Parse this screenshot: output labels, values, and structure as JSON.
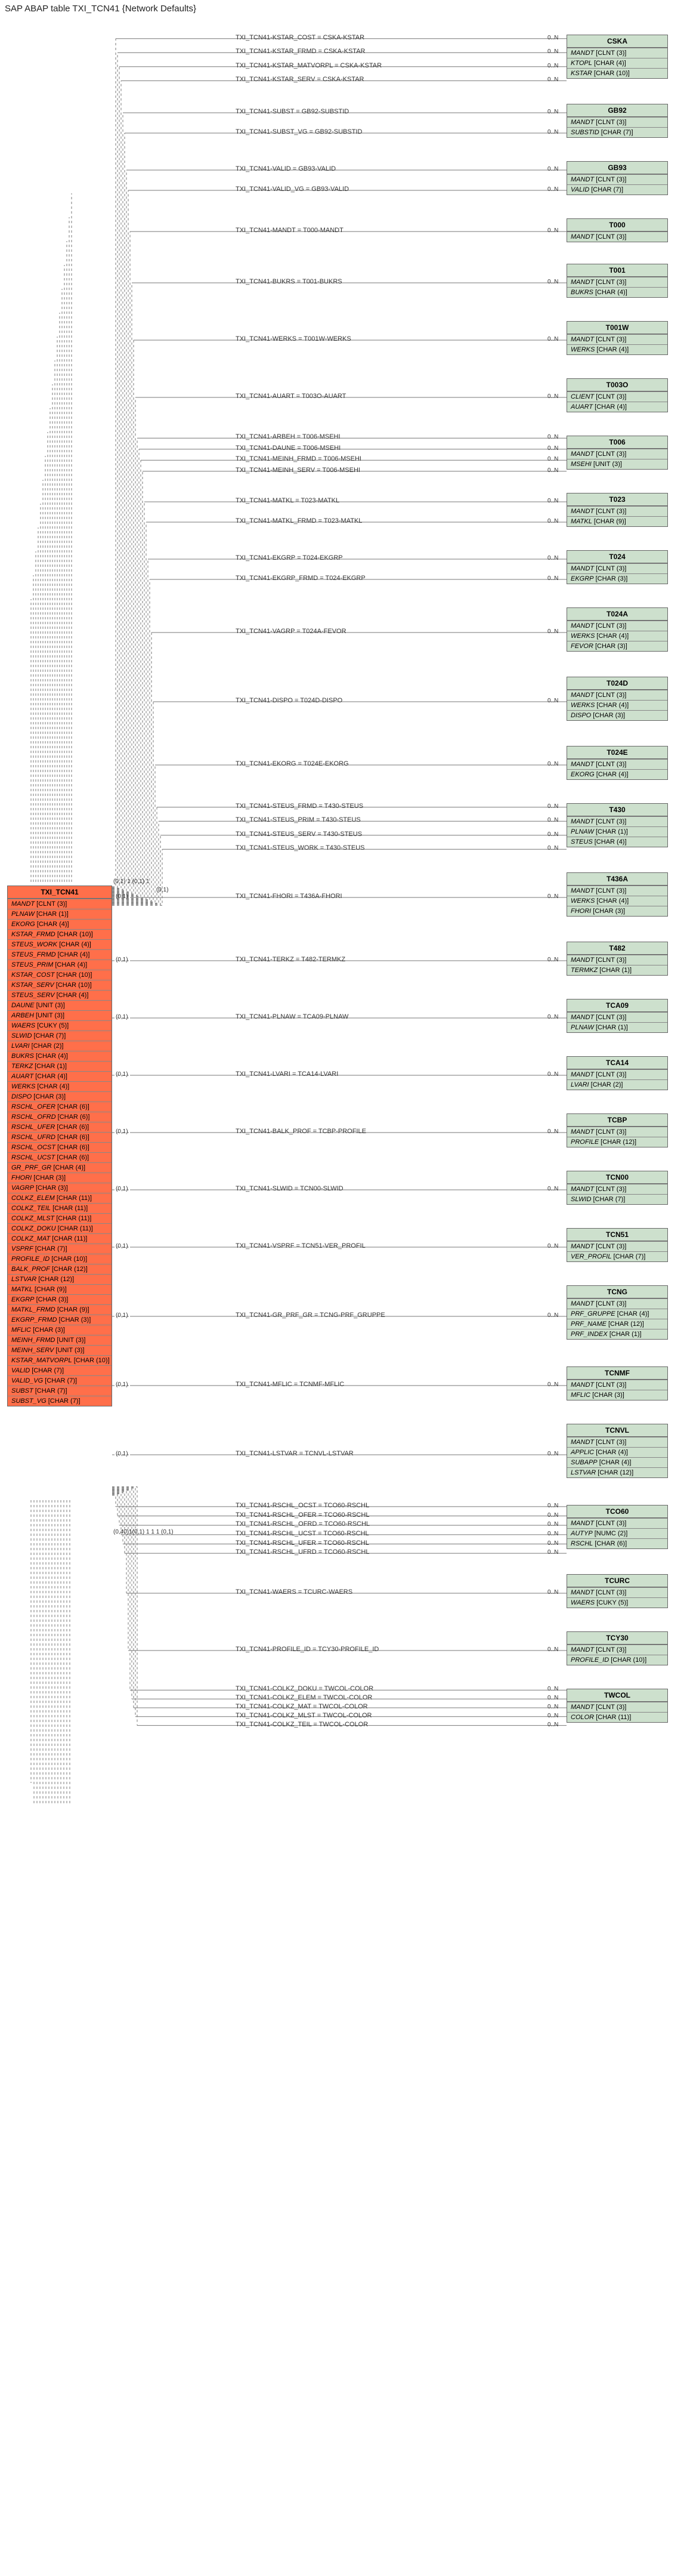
{
  "title": "SAP ABAP table TXI_TCN41 {Network Defaults}",
  "main_table": {
    "name": "TXI_TCN41",
    "fields": [
      {
        "name": "MANDT",
        "type": "[CLNT (3)]"
      },
      {
        "name": "PLNAW",
        "type": "[CHAR (1)]"
      },
      {
        "name": "EKORG",
        "type": "[CHAR (4)]"
      },
      {
        "name": "KSTAR_FRMD",
        "type": "[CHAR (10)]"
      },
      {
        "name": "STEUS_WORK",
        "type": "[CHAR (4)]"
      },
      {
        "name": "STEUS_FRMD",
        "type": "[CHAR (4)]"
      },
      {
        "name": "STEUS_PRIM",
        "type": "[CHAR (4)]"
      },
      {
        "name": "KSTAR_COST",
        "type": "[CHAR (10)]"
      },
      {
        "name": "KSTAR_SERV",
        "type": "[CHAR (10)]"
      },
      {
        "name": "STEUS_SERV",
        "type": "[CHAR (4)]"
      },
      {
        "name": "DAUNE",
        "type": "[UNIT (3)]"
      },
      {
        "name": "ARBEH",
        "type": "[UNIT (3)]"
      },
      {
        "name": "WAERS",
        "type": "[CUKY (5)]"
      },
      {
        "name": "SLWID",
        "type": "[CHAR (7)]"
      },
      {
        "name": "LVARI",
        "type": "[CHAR (2)]"
      },
      {
        "name": "BUKRS",
        "type": "[CHAR (4)]"
      },
      {
        "name": "TERKZ",
        "type": "[CHAR (1)]"
      },
      {
        "name": "AUART",
        "type": "[CHAR (4)]"
      },
      {
        "name": "WERKS",
        "type": "[CHAR (4)]"
      },
      {
        "name": "DISPO",
        "type": "[CHAR (3)]"
      },
      {
        "name": "RSCHL_OFER",
        "type": "[CHAR (6)]"
      },
      {
        "name": "RSCHL_OFRD",
        "type": "[CHAR (6)]"
      },
      {
        "name": "RSCHL_UFER",
        "type": "[CHAR (6)]"
      },
      {
        "name": "RSCHL_UFRD",
        "type": "[CHAR (6)]"
      },
      {
        "name": "RSCHL_OCST",
        "type": "[CHAR (6)]"
      },
      {
        "name": "RSCHL_UCST",
        "type": "[CHAR (6)]"
      },
      {
        "name": "GR_PRF_GR",
        "type": "[CHAR (4)]"
      },
      {
        "name": "FHORI",
        "type": "[CHAR (3)]"
      },
      {
        "name": "VAGRP",
        "type": "[CHAR (3)]"
      },
      {
        "name": "COLKZ_ELEM",
        "type": "[CHAR (11)]"
      },
      {
        "name": "COLKZ_TEIL",
        "type": "[CHAR (11)]"
      },
      {
        "name": "COLKZ_MLST",
        "type": "[CHAR (11)]"
      },
      {
        "name": "COLKZ_DOKU",
        "type": "[CHAR (11)]"
      },
      {
        "name": "COLKZ_MAT",
        "type": "[CHAR (11)]"
      },
      {
        "name": "VSPRF",
        "type": "[CHAR (7)]"
      },
      {
        "name": "PROFILE_ID",
        "type": "[CHAR (10)]"
      },
      {
        "name": "BALK_PROF",
        "type": "[CHAR (12)]"
      },
      {
        "name": "LSTVAR",
        "type": "[CHAR (12)]"
      },
      {
        "name": "MATKL",
        "type": "[CHAR (9)]"
      },
      {
        "name": "EKGRP",
        "type": "[CHAR (3)]"
      },
      {
        "name": "MATKL_FRMD",
        "type": "[CHAR (9)]"
      },
      {
        "name": "EKGRP_FRMD",
        "type": "[CHAR (3)]"
      },
      {
        "name": "MFLIC",
        "type": "[CHAR (3)]"
      },
      {
        "name": "MEINH_FRMD",
        "type": "[UNIT (3)]"
      },
      {
        "name": "MEINH_SERV",
        "type": "[UNIT (3)]"
      },
      {
        "name": "KSTAR_MATVORPL",
        "type": "[CHAR (10)]"
      },
      {
        "name": "VALID",
        "type": "[CHAR (7)]"
      },
      {
        "name": "VALID_VG",
        "type": "[CHAR (7)]"
      },
      {
        "name": "SUBST",
        "type": "[CHAR (7)]"
      },
      {
        "name": "SUBST_VG",
        "type": "[CHAR (7)]"
      }
    ]
  },
  "right_tables": [
    {
      "key": "CSKA",
      "name": "CSKA",
      "fields": [
        {
          "name": "MANDT",
          "type": "[CLNT (3)]"
        },
        {
          "name": "KTOPL",
          "type": "[CHAR (4)]"
        },
        {
          "name": "KSTAR",
          "type": "[CHAR (10)]"
        }
      ]
    },
    {
      "key": "GB92",
      "name": "GB92",
      "fields": [
        {
          "name": "MANDT",
          "type": "[CLNT (3)]"
        },
        {
          "name": "SUBSTID",
          "type": "[CHAR (7)]"
        }
      ]
    },
    {
      "key": "GB93",
      "name": "GB93",
      "fields": [
        {
          "name": "MANDT",
          "type": "[CLNT (3)]"
        },
        {
          "name": "VALID",
          "type": "[CHAR (7)]"
        }
      ]
    },
    {
      "key": "T000",
      "name": "T000",
      "fields": [
        {
          "name": "MANDT",
          "type": "[CLNT (3)]"
        }
      ]
    },
    {
      "key": "T001",
      "name": "T001",
      "fields": [
        {
          "name": "MANDT",
          "type": "[CLNT (3)]"
        },
        {
          "name": "BUKRS",
          "type": "[CHAR (4)]"
        }
      ]
    },
    {
      "key": "T001W",
      "name": "T001W",
      "fields": [
        {
          "name": "MANDT",
          "type": "[CLNT (3)]"
        },
        {
          "name": "WERKS",
          "type": "[CHAR (4)]"
        }
      ]
    },
    {
      "key": "T003O",
      "name": "T003O",
      "fields": [
        {
          "name": "CLIENT",
          "type": "[CLNT (3)]"
        },
        {
          "name": "AUART",
          "type": "[CHAR (4)]"
        }
      ]
    },
    {
      "key": "T006",
      "name": "T006",
      "fields": [
        {
          "name": "MANDT",
          "type": "[CLNT (3)]"
        },
        {
          "name": "MSEHI",
          "type": "[UNIT (3)]"
        }
      ]
    },
    {
      "key": "T023",
      "name": "T023",
      "fields": [
        {
          "name": "MANDT",
          "type": "[CLNT (3)]"
        },
        {
          "name": "MATKL",
          "type": "[CHAR (9)]"
        }
      ]
    },
    {
      "key": "T024",
      "name": "T024",
      "fields": [
        {
          "name": "MANDT",
          "type": "[CLNT (3)]"
        },
        {
          "name": "EKGRP",
          "type": "[CHAR (3)]"
        }
      ]
    },
    {
      "key": "T024A",
      "name": "T024A",
      "fields": [
        {
          "name": "MANDT",
          "type": "[CLNT (3)]"
        },
        {
          "name": "WERKS",
          "type": "[CHAR (4)]"
        },
        {
          "name": "FEVOR",
          "type": "[CHAR (3)]"
        }
      ]
    },
    {
      "key": "T024D",
      "name": "T024D",
      "fields": [
        {
          "name": "MANDT",
          "type": "[CLNT (3)]"
        },
        {
          "name": "WERKS",
          "type": "[CHAR (4)]"
        },
        {
          "name": "DISPO",
          "type": "[CHAR (3)]"
        }
      ]
    },
    {
      "key": "T024E",
      "name": "T024E",
      "fields": [
        {
          "name": "MANDT",
          "type": "[CLNT (3)]"
        },
        {
          "name": "EKORG",
          "type": "[CHAR (4)]"
        }
      ]
    },
    {
      "key": "T430",
      "name": "T430",
      "fields": [
        {
          "name": "MANDT",
          "type": "[CLNT (3)]"
        },
        {
          "name": "PLNAW",
          "type": "[CHAR (1)]"
        },
        {
          "name": "STEUS",
          "type": "[CHAR (4)]"
        }
      ]
    },
    {
      "key": "T436A",
      "name": "T436A",
      "fields": [
        {
          "name": "MANDT",
          "type": "[CLNT (3)]"
        },
        {
          "name": "WERKS",
          "type": "[CHAR (4)]"
        },
        {
          "name": "FHORI",
          "type": "[CHAR (3)]"
        }
      ]
    },
    {
      "key": "T482",
      "name": "T482",
      "fields": [
        {
          "name": "MANDT",
          "type": "[CLNT (3)]"
        },
        {
          "name": "TERMKZ",
          "type": "[CHAR (1)]"
        }
      ]
    },
    {
      "key": "TCA09",
      "name": "TCA09",
      "fields": [
        {
          "name": "MANDT",
          "type": "[CLNT (3)]"
        },
        {
          "name": "PLNAW",
          "type": "[CHAR (1)]"
        }
      ]
    },
    {
      "key": "TCA14",
      "name": "TCA14",
      "fields": [
        {
          "name": "MANDT",
          "type": "[CLNT (3)]"
        },
        {
          "name": "LVARI",
          "type": "[CHAR (2)]"
        }
      ]
    },
    {
      "key": "TCBP",
      "name": "TCBP",
      "fields": [
        {
          "name": "MANDT",
          "type": "[CLNT (3)]"
        },
        {
          "name": "PROFILE",
          "type": "[CHAR (12)]"
        }
      ]
    },
    {
      "key": "TCN00",
      "name": "TCN00",
      "fields": [
        {
          "name": "MANDT",
          "type": "[CLNT (3)]"
        },
        {
          "name": "SLWID",
          "type": "[CHAR (7)]"
        }
      ]
    },
    {
      "key": "TCN51",
      "name": "TCN51",
      "fields": [
        {
          "name": "MANDT",
          "type": "[CLNT (3)]"
        },
        {
          "name": "VER_PROFIL",
          "type": "[CHAR (7)]"
        }
      ]
    },
    {
      "key": "TCNG",
      "name": "TCNG",
      "fields": [
        {
          "name": "MANDT",
          "type": "[CLNT (3)]"
        },
        {
          "name": "PRF_GRUPPE",
          "type": "[CHAR (4)]"
        },
        {
          "name": "PRF_NAME",
          "type": "[CHAR (12)]"
        },
        {
          "name": "PRF_INDEX",
          "type": "[CHAR (1)]"
        }
      ]
    },
    {
      "key": "TCNMF",
      "name": "TCNMF",
      "fields": [
        {
          "name": "MANDT",
          "type": "[CLNT (3)]"
        },
        {
          "name": "MFLIC",
          "type": "[CHAR (3)]"
        }
      ]
    },
    {
      "key": "TCNVL",
      "name": "TCNVL",
      "fields": [
        {
          "name": "MANDT",
          "type": "[CLNT (3)]"
        },
        {
          "name": "APPLIC",
          "type": "[CHAR (4)]"
        },
        {
          "name": "SUBAPP",
          "type": "[CHAR (4)]"
        },
        {
          "name": "LSTVAR",
          "type": "[CHAR (12)]"
        }
      ]
    },
    {
      "key": "TCO60",
      "name": "TCO60",
      "fields": [
        {
          "name": "MANDT",
          "type": "[CLNT (3)]"
        },
        {
          "name": "AUTYP",
          "type": "[NUMC (2)]"
        },
        {
          "name": "RSCHL",
          "type": "[CHAR (6)]"
        }
      ]
    },
    {
      "key": "TCURC",
      "name": "TCURC",
      "fields": [
        {
          "name": "MANDT",
          "type": "[CLNT (3)]"
        },
        {
          "name": "WAERS",
          "type": "[CUKY (5)]"
        }
      ]
    },
    {
      "key": "TCY30",
      "name": "TCY30",
      "fields": [
        {
          "name": "MANDT",
          "type": "[CLNT (3)]"
        },
        {
          "name": "PROFILE_ID",
          "type": "[CHAR (10)]"
        }
      ]
    },
    {
      "key": "TWCOL",
      "name": "TWCOL",
      "fields": [
        {
          "name": "MANDT",
          "type": "[CLNT (3)]"
        },
        {
          "name": "COLOR",
          "type": "[CHAR (11)]"
        }
      ]
    }
  ],
  "edges": [
    {
      "label": "TXI_TCN41-KSTAR_COST = CSKA-KSTAR",
      "target": "CSKA",
      "rc": "0..N"
    },
    {
      "label": "TXI_TCN41-KSTAR_FRMD = CSKA-KSTAR",
      "target": "CSKA",
      "rc": "0..N"
    },
    {
      "label": "TXI_TCN41-KSTAR_MATVORPL = CSKA-KSTAR",
      "target": "CSKA",
      "rc": "0..N"
    },
    {
      "label": "TXI_TCN41-KSTAR_SERV = CSKA-KSTAR",
      "target": "CSKA",
      "rc": "0..N"
    },
    {
      "label": "TXI_TCN41-SUBST = GB92-SUBSTID",
      "target": "GB92",
      "rc": "0..N"
    },
    {
      "label": "TXI_TCN41-SUBST_VG = GB92-SUBSTID",
      "target": "GB92",
      "rc": "0..N"
    },
    {
      "label": "TXI_TCN41-VALID = GB93-VALID",
      "target": "GB93",
      "rc": "0..N"
    },
    {
      "label": "TXI_TCN41-VALID_VG = GB93-VALID",
      "target": "GB93",
      "rc": "0..N"
    },
    {
      "label": "TXI_TCN41-MANDT = T000-MANDT",
      "target": "T000",
      "rc": "0..N"
    },
    {
      "label": "TXI_TCN41-BUKRS = T001-BUKRS",
      "target": "T001",
      "rc": "0..N"
    },
    {
      "label": "TXI_TCN41-WERKS = T001W-WERKS",
      "target": "T001W",
      "rc": "0..N"
    },
    {
      "label": "TXI_TCN41-AUART = T003O-AUART",
      "target": "T003O",
      "rc": "0..N"
    },
    {
      "label": "TXI_TCN41-ARBEH = T006-MSEHI",
      "target": "T006",
      "rc": "0..N"
    },
    {
      "label": "TXI_TCN41-DAUNE = T006-MSEHI",
      "target": "T006",
      "rc": "0..N"
    },
    {
      "label": "TXI_TCN41-MEINH_FRMD = T006-MSEHI",
      "target": "T006",
      "rc": "0..N"
    },
    {
      "label": "TXI_TCN41-MEINH_SERV = T006-MSEHI",
      "target": "T006",
      "rc": "0..N"
    },
    {
      "label": "TXI_TCN41-MATKL = T023-MATKL",
      "target": "T023",
      "rc": "0..N"
    },
    {
      "label": "TXI_TCN41-MATKL_FRMD = T023-MATKL",
      "target": "T023",
      "rc": "0..N"
    },
    {
      "label": "TXI_TCN41-EKGRP = T024-EKGRP",
      "target": "T024",
      "rc": "0..N"
    },
    {
      "label": "TXI_TCN41-EKGRP_FRMD = T024-EKGRP",
      "target": "T024",
      "rc": "0..N"
    },
    {
      "label": "TXI_TCN41-VAGRP = T024A-FEVOR",
      "target": "T024A",
      "rc": "0..N"
    },
    {
      "label": "TXI_TCN41-DISPO = T024D-DISPO",
      "target": "T024D",
      "rc": "0..N"
    },
    {
      "label": "TXI_TCN41-EKORG = T024E-EKORG",
      "target": "T024E",
      "rc": "0..N"
    },
    {
      "label": "TXI_TCN41-STEUS_FRMD = T430-STEUS",
      "target": "T430",
      "rc": "0..N"
    },
    {
      "label": "TXI_TCN41-STEUS_PRIM = T430-STEUS",
      "target": "T430",
      "rc": "0..N"
    },
    {
      "label": "TXI_TCN41-STEUS_SERV = T430-STEUS",
      "target": "T430",
      "rc": "0..N"
    },
    {
      "label": "TXI_TCN41-STEUS_WORK = T430-STEUS",
      "target": "T430",
      "rc": "0..N"
    },
    {
      "label": "TXI_TCN41-FHORI = T436A-FHORI",
      "target": "T436A",
      "rc": "0..N"
    },
    {
      "label": "TXI_TCN41-TERKZ = T482-TERMKZ",
      "target": "T482",
      "rc": "0..N"
    },
    {
      "label": "TXI_TCN41-PLNAW = TCA09-PLNAW",
      "target": "TCA09",
      "rc": "0..N"
    },
    {
      "label": "TXI_TCN41-LVARI = TCA14-LVARI",
      "target": "TCA14",
      "rc": "0..N"
    },
    {
      "label": "TXI_TCN41-BALK_PROF = TCBP-PROFILE",
      "target": "TCBP",
      "rc": "0..N"
    },
    {
      "label": "TXI_TCN41-SLWID = TCN00-SLWID",
      "target": "TCN00",
      "rc": "0..N"
    },
    {
      "label": "TXI_TCN41-VSPRF = TCN51-VER_PROFIL",
      "target": "TCN51",
      "rc": "0..N"
    },
    {
      "label": "TXI_TCN41-GR_PRF_GR = TCNG-PRF_GRUPPE",
      "target": "TCNG",
      "rc": "0..N"
    },
    {
      "label": "TXI_TCN41-MFLIC = TCNMF-MFLIC",
      "target": "TCNMF",
      "rc": "0..N"
    },
    {
      "label": "TXI_TCN41-LSTVAR = TCNVL-LSTVAR",
      "target": "TCNVL",
      "rc": "0..N"
    },
    {
      "label": "TXI_TCN41-RSCHL_OCST = TCO60-RSCHL",
      "target": "TCO60",
      "rc": "0..N"
    },
    {
      "label": "TXI_TCN41-RSCHL_OFER = TCO60-RSCHL",
      "target": "TCO60",
      "rc": "0..N"
    },
    {
      "label": "TXI_TCN41-RSCHL_OFRD = TCO60-RSCHL",
      "target": "TCO60",
      "rc": "0..N"
    },
    {
      "label": "TXI_TCN41-RSCHL_UCST = TCO60-RSCHL",
      "target": "TCO60",
      "rc": "0..N"
    },
    {
      "label": "TXI_TCN41-RSCHL_UFER = TCO60-RSCHL",
      "target": "TCO60",
      "rc": "0..N"
    },
    {
      "label": "TXI_TCN41-RSCHL_UFRD = TCO60-RSCHL",
      "target": "TCO60",
      "rc": "0..N"
    },
    {
      "label": "TXI_TCN41-WAERS = TCURC-WAERS",
      "target": "TCURC",
      "rc": "0..N"
    },
    {
      "label": "TXI_TCN41-PROFILE_ID = TCY30-PROFILE_ID",
      "target": "TCY30",
      "rc": "0..N"
    },
    {
      "label": "TXI_TCN41-COLKZ_DOKU = TWCOL-COLOR",
      "target": "TWCOL",
      "rc": "0..N"
    },
    {
      "label": "TXI_TCN41-COLKZ_ELEM = TWCOL-COLOR",
      "target": "TWCOL",
      "rc": "0..N"
    },
    {
      "label": "TXI_TCN41-COLKZ_MAT = TWCOL-COLOR",
      "target": "TWCOL",
      "rc": "0..N"
    },
    {
      "label": "TXI_TCN41-COLKZ_MLST = TWCOL-COLOR",
      "target": "TWCOL",
      "rc": "0..N"
    },
    {
      "label": "TXI_TCN41-COLKZ_TEIL = TWCOL-COLOR",
      "target": "TWCOL",
      "rc": "0..N"
    }
  ],
  "left_cards": {
    "upper_token": "(0,1) 1 (0,1) 1",
    "upper_single": "(0,1)",
    "per_edge_left": [
      "(0,1)",
      "(0,1)",
      "(0,1)",
      "(0,1)",
      "(0,1)",
      "(0,1)",
      "(0,1)",
      "(0,1)",
      "(0,1)",
      "(0,1)",
      "1",
      "1",
      "1",
      "1",
      "(0,1)",
      "1",
      "1",
      "1",
      "1",
      "1",
      "(0,1)",
      "(0,1)"
    ],
    "below_token": "(0,40)1(0,1) 1 1 1 (0,1)"
  }
}
